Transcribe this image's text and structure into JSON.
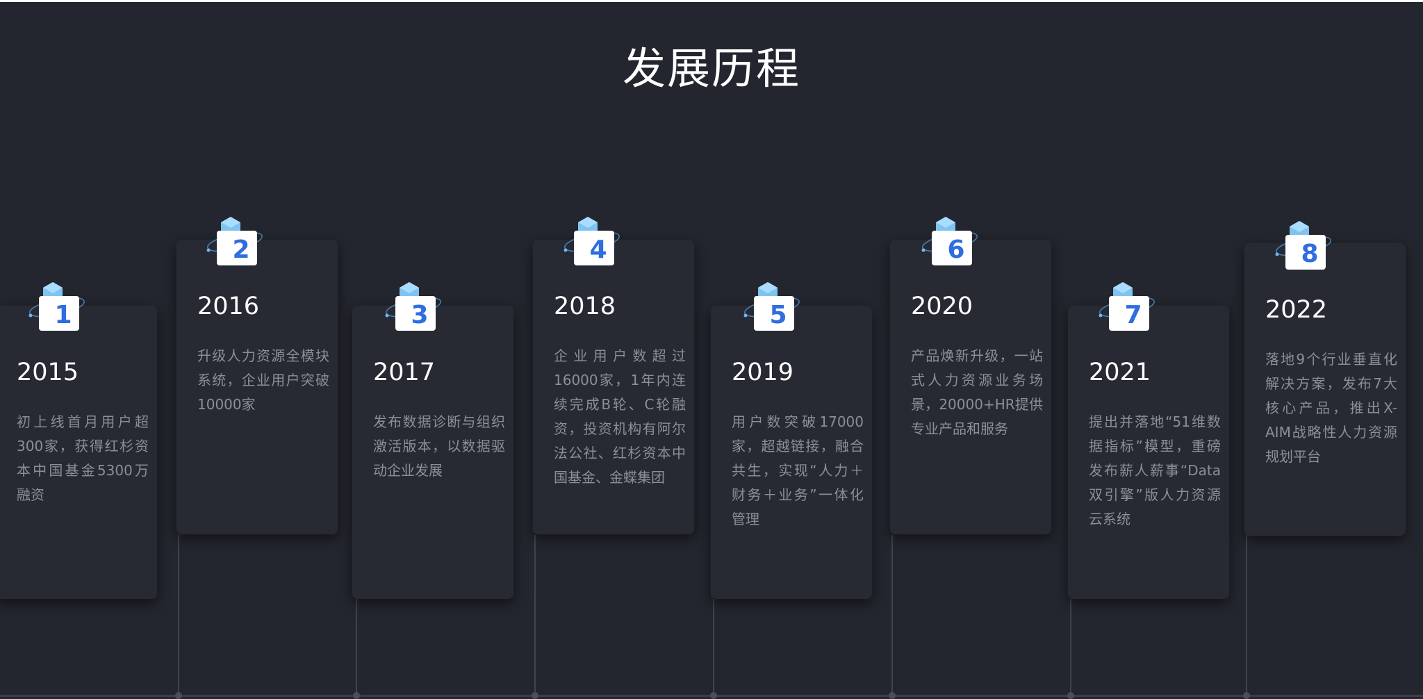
{
  "page": {
    "title": "发展历程"
  },
  "timeline": [
    {
      "number": "1",
      "year": "2015",
      "desc": "初上线首月用户超300家，获得红杉资本中国基金5300万融资"
    },
    {
      "number": "2",
      "year": "2016",
      "desc": "升级人力资源全模块系统，企业用户突破10000家"
    },
    {
      "number": "3",
      "year": "2017",
      "desc": "发布数据诊断与组织激活版本，以数据驱动企业发展"
    },
    {
      "number": "4",
      "year": "2018",
      "desc": "企业用户数超过16000家，1年内连续完成B轮、C轮融资，投资机构有阿尔法公社、红杉资本中国基金、金蝶集团"
    },
    {
      "number": "5",
      "year": "2019",
      "desc": "用户数突破17000家，超越链接，融合共生，实现“人力＋财务＋业务”一体化管理"
    },
    {
      "number": "6",
      "year": "2020",
      "desc": "产品焕新升级，一站式人力资源业务场景，20000+HR提供专业产品和服务"
    },
    {
      "number": "7",
      "year": "2021",
      "desc": "提出并落地“51维数据指标”模型，重磅发布薪人薪事“Data双引擎”版人力资源云系统"
    },
    {
      "number": "8",
      "year": "2022",
      "desc": "落地9个行业垂直化解决方案，发布7大核心产品，推出X-AIM战略性人力资源规划平台"
    }
  ]
}
